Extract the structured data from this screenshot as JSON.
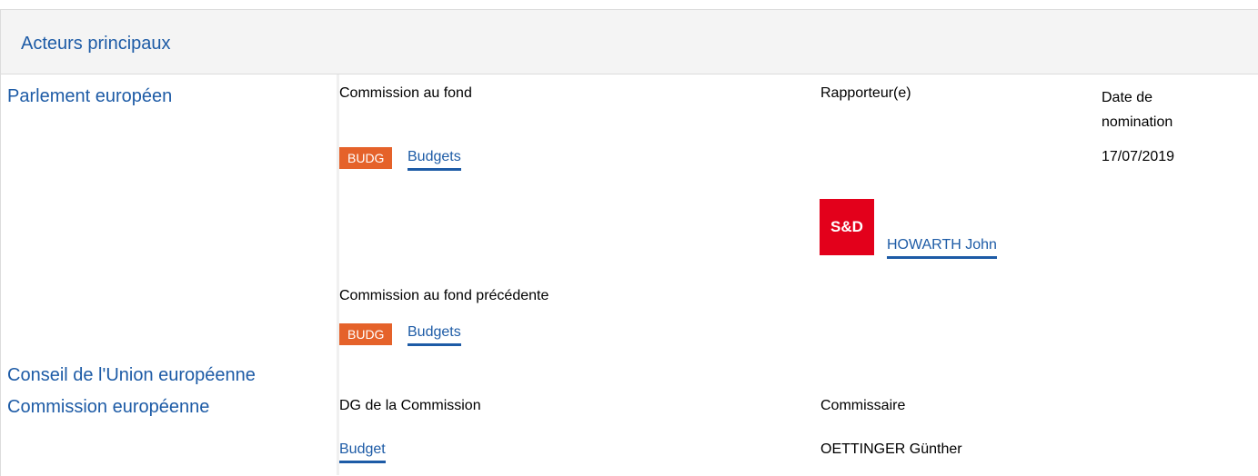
{
  "section": {
    "title": "Acteurs principaux"
  },
  "parliament": {
    "institution": "Parlement européen",
    "committee_header": "Commission au fond",
    "rapporteur_header": "Rapporteur(e)",
    "date_header": "Date de nomination",
    "committee": {
      "badge": "BUDG",
      "name": "Budgets"
    },
    "date": "17/07/2019",
    "rapporteur": {
      "party_logo": "S&D",
      "name": "HOWARTH John"
    },
    "previous_committee_header": "Commission au fond précédente",
    "previous_committee": {
      "badge": "BUDG",
      "name": "Budgets"
    },
    "colors": {
      "badge": "#e5622a",
      "party": "#e3001b",
      "link": "#1d5ba6"
    }
  },
  "council": {
    "institution": "Conseil de l'Union européenne"
  },
  "commission": {
    "institution": "Commission européenne",
    "dg_header": "DG de la Commission",
    "commissioner_header": "Commissaire",
    "dg": "Budget",
    "commissioner": "OETTINGER Günther"
  }
}
